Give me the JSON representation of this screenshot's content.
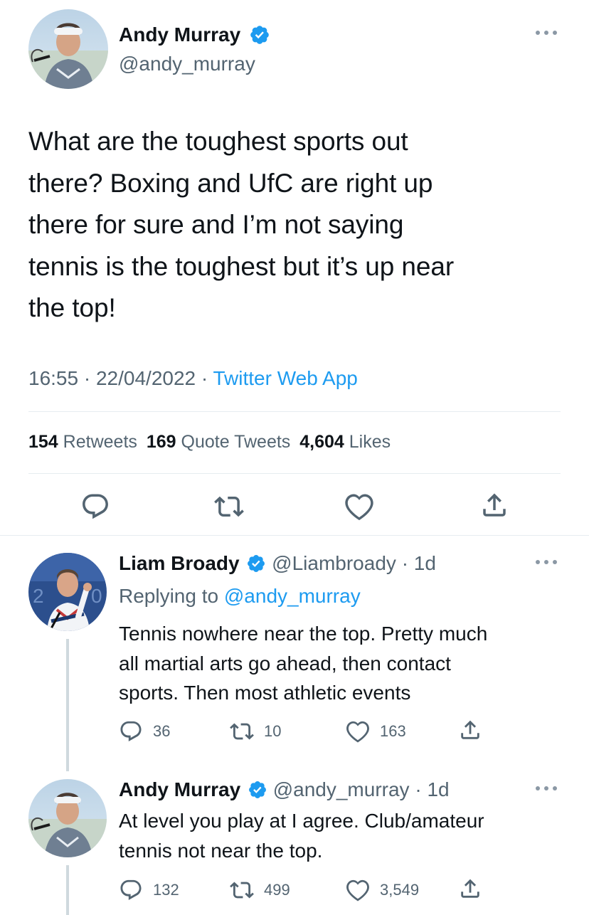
{
  "main_tweet": {
    "name": "Andy Murray",
    "handle": "@andy_murray",
    "text_lines": [
      "What are the toughest sports out",
      "there? Boxing and UfC are right up",
      "there for sure and I’m not saying",
      "tennis is the toughest but it’s up near",
      "the top!"
    ],
    "time": "16:55",
    "date": "22/04/2022",
    "dot": "·",
    "source": "Twitter Web App",
    "stats": {
      "retweets_count": "154",
      "retweets_label": "Retweets",
      "quotes_count": "169",
      "quotes_label": "Quote Tweets",
      "likes_count": "4,604",
      "likes_label": "Likes"
    }
  },
  "replies": [
    {
      "name": "Liam Broady",
      "handle": "@Liambroady",
      "age": "· 1d",
      "replying_prefix": "Replying to",
      "replying_handle": "@andy_murray",
      "text_lines": [
        "Tennis nowhere near the top. Pretty much",
        "all martial arts go ahead, then contact",
        "sports. Then most athletic events"
      ],
      "replies_count": "36",
      "retweets_count": "10",
      "likes_count": "163"
    },
    {
      "name": "Andy Murray",
      "handle": "@andy_murray",
      "age": "· 1d",
      "text_lines": [
        "At level you play at I agree. Club/amateur",
        "tennis not near the top."
      ],
      "replies_count": "132",
      "retweets_count": "499",
      "likes_count": "3,549"
    }
  ],
  "colors": {
    "accent": "#1d9bf0",
    "verified": "#1d9bf0",
    "muted_text": "#536471"
  },
  "icons": [
    "verified-badge-icon",
    "more-icon",
    "reply-icon",
    "retweet-icon",
    "like-icon",
    "share-icon"
  ]
}
